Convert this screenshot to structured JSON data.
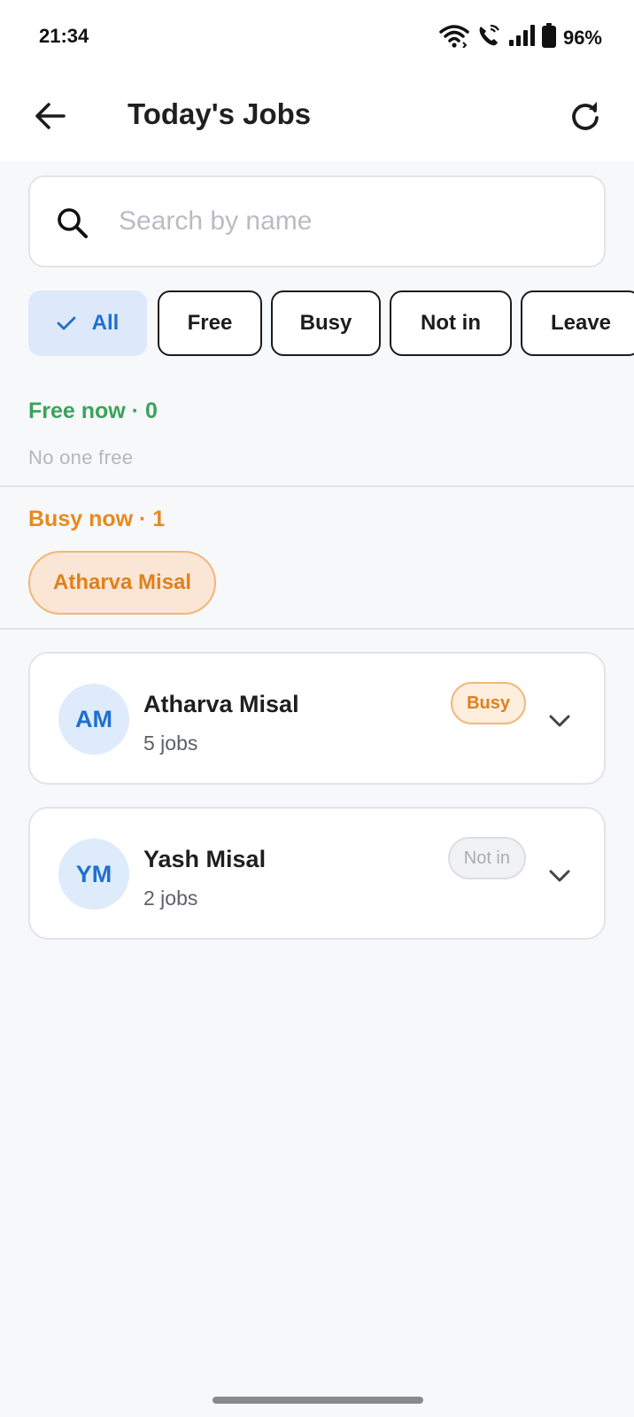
{
  "status_bar": {
    "time": "21:34",
    "battery": "96%",
    "icons": [
      "wifi-icon",
      "wifi-calling-icon",
      "signal-icon",
      "battery-icon"
    ]
  },
  "header": {
    "title": "Today's Jobs",
    "back_icon": "arrow-left-icon",
    "refresh_icon": "refresh-icon"
  },
  "search": {
    "placeholder": "Search by name",
    "value": ""
  },
  "filters": [
    {
      "label": "All",
      "selected": true
    },
    {
      "label": "Free",
      "selected": false
    },
    {
      "label": "Busy",
      "selected": false
    },
    {
      "label": "Not in",
      "selected": false
    },
    {
      "label": "Leave",
      "selected": false
    }
  ],
  "free_section": {
    "title": "Free now · 0",
    "empty_text": "No one free",
    "color": "#3aa35a"
  },
  "busy_section": {
    "title": "Busy now · 1",
    "people": [
      "Atharva Misal"
    ],
    "color": "#e68a1f"
  },
  "people": [
    {
      "initials": "AM",
      "name": "Atharva Misal",
      "jobs": "5 jobs",
      "status": "Busy"
    },
    {
      "initials": "YM",
      "name": "Yash Misal",
      "jobs": "2 jobs",
      "status": "Not in"
    }
  ],
  "colors": {
    "accent_blue": "#1f6fd1",
    "busy_orange": "#e0801b",
    "free_green": "#3aa35a"
  }
}
